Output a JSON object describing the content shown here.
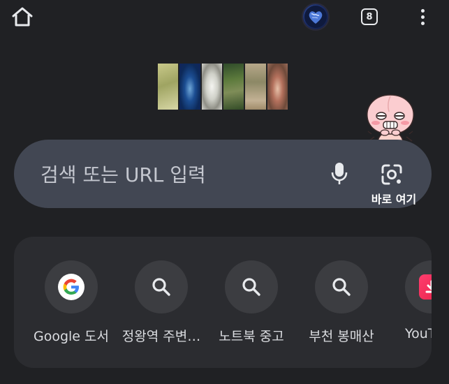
{
  "top_bar": {
    "tab_count": "8",
    "icons": {
      "home": "home-icon",
      "avatar": "account-avatar-globe",
      "tabs": "tab-switcher-icon",
      "menu": "more-vert-icon"
    }
  },
  "doodle": {
    "icon": "google-doodle-satellite-imagery"
  },
  "search": {
    "placeholder": "검색 또는 URL 입력",
    "lens_label": "바로 여기",
    "icons": {
      "mic": "mic-icon",
      "lens": "google-lens-icon",
      "mascot": "kakao-friends-apeach-mascot"
    }
  },
  "shortcuts": [
    {
      "label": "Google 도서",
      "icon": "google-g-icon"
    },
    {
      "label": "정왕역 주변…",
      "icon": "search-icon"
    },
    {
      "label": "노트북 중고",
      "icon": "search-icon"
    },
    {
      "label": "부천 봉매산",
      "icon": "search-icon"
    },
    {
      "label": "YouTu",
      "icon": "youtube-download-icon"
    }
  ],
  "colors": {
    "background": "#202124",
    "search_bar": "#424753",
    "shortcuts_panel": "#2b2c30",
    "shortcut_circle": "#3c3d41"
  }
}
